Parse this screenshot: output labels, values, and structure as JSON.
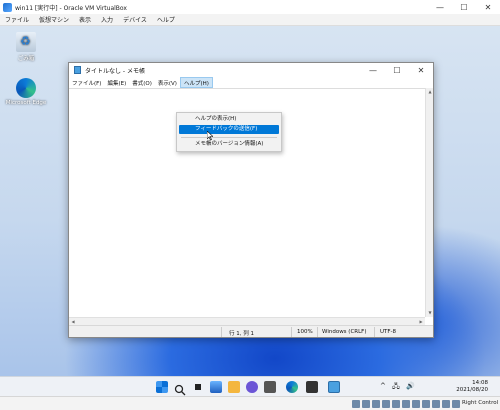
{
  "vbox": {
    "title": "win11 [実行中] - Oracle VM VirtualBox",
    "menu": [
      "ファイル",
      "仮想マシン",
      "表示",
      "入力",
      "デバイス",
      "ヘルプ"
    ],
    "minimize": "—",
    "maximize": "☐",
    "close": "✕",
    "host_key": "Right Control"
  },
  "desktop": {
    "icons": [
      {
        "label": "ごみ箱",
        "icon": "recycle-bin-icon"
      },
      {
        "label": "Microsoft Edge",
        "icon": "edge-icon"
      }
    ]
  },
  "notepad": {
    "title": "タイトルなし - メモ帳",
    "menu": [
      "ファイル(F)",
      "編集(E)",
      "書式(O)",
      "表示(V)",
      "ヘルプ(H)"
    ],
    "minimize": "—",
    "maximize": "☐",
    "close": "✕",
    "status": {
      "position": "行 1, 列 1",
      "zoom": "100%",
      "line_ending": "Windows (CRLF)",
      "encoding": "UTF-8"
    }
  },
  "help_menu": {
    "items": [
      "ヘルプの表示(H)",
      "フィードバックの送信(F)",
      "メモ帳のバージョン情報(A)"
    ],
    "highlighted": "フィードバックの送信(F)"
  },
  "taskbar": {
    "time": "14:08",
    "date": "2021/08/20"
  },
  "colors": {
    "accent": "#0078d7",
    "menu_active": "#cce4f7"
  }
}
